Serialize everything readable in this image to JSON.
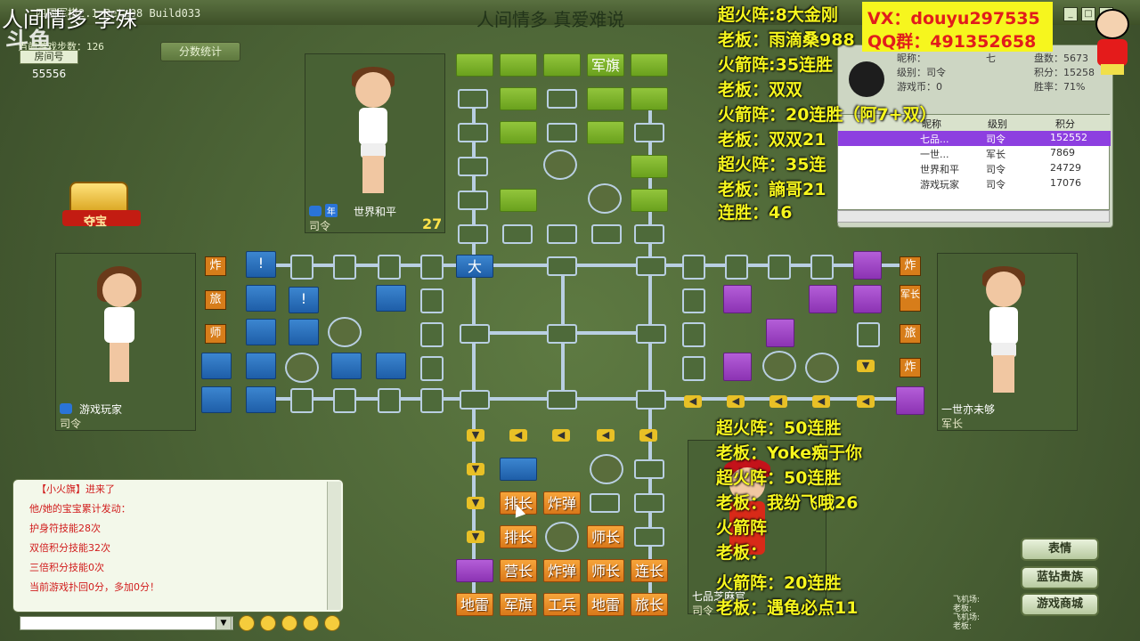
{
  "window": {
    "title": "四国军棋2.1 Beta08 Build033",
    "banner": "人间情多 真爱难说",
    "controls": [
      "_",
      "□",
      "×"
    ]
  },
  "stream_overlay": {
    "top_title": "人间情多     李殊",
    "logo": "斗鱼"
  },
  "top_left": {
    "steps_label": "当前游戏步数：126",
    "room_label": "房间号",
    "room_number": "55556",
    "score_button": "分数统计",
    "treasure_label": "夺宝"
  },
  "players": {
    "top": {
      "name": "世界和平",
      "rank": "司令",
      "timer": "27"
    },
    "left": {
      "name": "游戏玩家",
      "rank": "司令"
    },
    "right": {
      "name": "一世亦未够",
      "rank": "军长"
    },
    "bottom": {
      "name": "七品芝麻官",
      "rank": "司令"
    }
  },
  "board": {
    "top_flag": "军旗",
    "blue_da": "大",
    "left_tags": [
      "炸",
      "旅",
      "师"
    ],
    "left_excl": [
      "!",
      "!"
    ],
    "right_tags": [
      "炸",
      "军长",
      "旅",
      "炸"
    ],
    "bottom_rows": [
      [
        "排长",
        "炸弹"
      ],
      [
        "排长",
        "师长"
      ],
      [
        "营长",
        "炸弹",
        "师长",
        "连长"
      ],
      [
        "地雷",
        "军旗",
        "工兵",
        "地雷",
        "旅长"
      ]
    ]
  },
  "overlay_top": [
    "超火阵:8大金刚",
    "老板：雨滴桑988",
    "火箭阵:35连胜",
    "老板：双双",
    "火箭阵：20连胜（阿7+双）",
    "老板：双双21",
    "超火阵：35连",
    "老板：謪哥21",
    "连胜：46"
  ],
  "overlay_bottom": [
    "超火阵：50连胜",
    "老板：Yoke痴于你",
    "超火阵：50连胜",
    "老板：我纷飞哦26",
    "火箭阵",
    "老板：",
    "火箭阵：20连胜",
    "老板：遇龟必点11"
  ],
  "contact": {
    "vx": "VX：douyu297535",
    "qq": "QQ群：491352658"
  },
  "info": {
    "nick_label": "昵称：",
    "nick_value": "七",
    "rank_label": "级别：司令",
    "coin_label": "游戏币：0",
    "games_label": "盘数：5673",
    "score_label": "积分：15258",
    "winrate_label": "胜率：71%"
  },
  "table": {
    "headers": [
      "昵称",
      "级别",
      "积分"
    ],
    "rows": [
      {
        "name": "七品...",
        "rank": "司令",
        "score": "152552"
      },
      {
        "name": "一世...",
        "rank": "军长",
        "score": "7869"
      },
      {
        "name": "世界和平",
        "rank": "司令",
        "score": "24729"
      },
      {
        "name": "游戏玩家",
        "rank": "司令",
        "score": "17076"
      }
    ]
  },
  "chat": {
    "lines": [
      "【小火旗】进来了",
      "他/她的宝宝累计发动：",
      "护身符技能28次",
      "双倍积分技能32次",
      "三倍积分技能0次",
      "当前游戏扑回0分，多加0分！"
    ]
  },
  "side_buttons": [
    "表情",
    "蓝钻贵族",
    "游戏商城"
  ],
  "right_small": [
    "飞机场:",
    "老板:",
    "飞机场:",
    "老板:"
  ],
  "colors": {
    "green_piece": "#7bb02a",
    "blue_piece": "#2a6cb8",
    "purple_piece": "#a14cc9",
    "orange_piece": "#e88a25",
    "overlay_yellow": "#f6f61e"
  }
}
